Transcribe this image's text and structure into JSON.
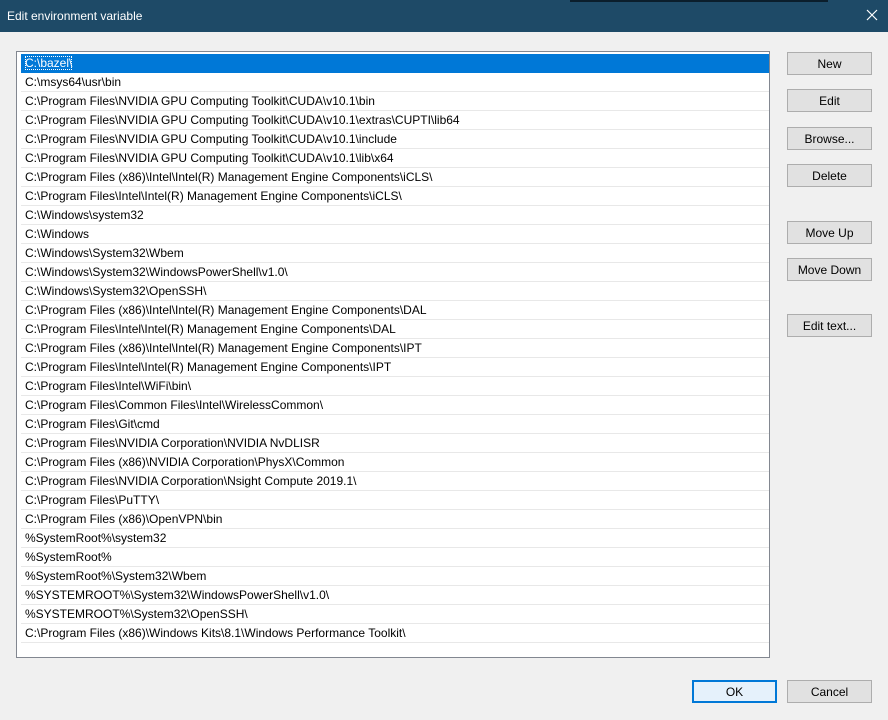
{
  "window": {
    "title": "Edit environment variable"
  },
  "list": {
    "selected_index": 0,
    "items": [
      "C:\\bazel\\",
      "C:\\msys64\\usr\\bin",
      "C:\\Program Files\\NVIDIA GPU Computing Toolkit\\CUDA\\v10.1\\bin",
      "C:\\Program Files\\NVIDIA GPU Computing Toolkit\\CUDA\\v10.1\\extras\\CUPTI\\lib64",
      "C:\\Program Files\\NVIDIA GPU Computing Toolkit\\CUDA\\v10.1\\include",
      "C:\\Program Files\\NVIDIA GPU Computing Toolkit\\CUDA\\v10.1\\lib\\x64",
      "C:\\Program Files (x86)\\Intel\\Intel(R) Management Engine Components\\iCLS\\",
      "C:\\Program Files\\Intel\\Intel(R) Management Engine Components\\iCLS\\",
      "C:\\Windows\\system32",
      "C:\\Windows",
      "C:\\Windows\\System32\\Wbem",
      "C:\\Windows\\System32\\WindowsPowerShell\\v1.0\\",
      "C:\\Windows\\System32\\OpenSSH\\",
      "C:\\Program Files (x86)\\Intel\\Intel(R) Management Engine Components\\DAL",
      "C:\\Program Files\\Intel\\Intel(R) Management Engine Components\\DAL",
      "C:\\Program Files (x86)\\Intel\\Intel(R) Management Engine Components\\IPT",
      "C:\\Program Files\\Intel\\Intel(R) Management Engine Components\\IPT",
      "C:\\Program Files\\Intel\\WiFi\\bin\\",
      "C:\\Program Files\\Common Files\\Intel\\WirelessCommon\\",
      "C:\\Program Files\\Git\\cmd",
      "C:\\Program Files\\NVIDIA Corporation\\NVIDIA NvDLISR",
      "C:\\Program Files (x86)\\NVIDIA Corporation\\PhysX\\Common",
      "C:\\Program Files\\NVIDIA Corporation\\Nsight Compute 2019.1\\",
      "C:\\Program Files\\PuTTY\\",
      "C:\\Program Files (x86)\\OpenVPN\\bin",
      "%SystemRoot%\\system32",
      "%SystemRoot%",
      "%SystemRoot%\\System32\\Wbem",
      "%SYSTEMROOT%\\System32\\WindowsPowerShell\\v1.0\\",
      "%SYSTEMROOT%\\System32\\OpenSSH\\",
      "C:\\Program Files (x86)\\Windows Kits\\8.1\\Windows Performance Toolkit\\"
    ]
  },
  "buttons": {
    "new": "New",
    "edit": "Edit",
    "browse": "Browse...",
    "delete": "Delete",
    "move_up": "Move Up",
    "move_down": "Move Down",
    "edit_text": "Edit text...",
    "ok": "OK",
    "cancel": "Cancel"
  },
  "icons": {
    "close": "close-icon"
  },
  "colors": {
    "titlebar": "#1e4a67",
    "selection": "#0078d7",
    "background": "#f0f0f0"
  }
}
